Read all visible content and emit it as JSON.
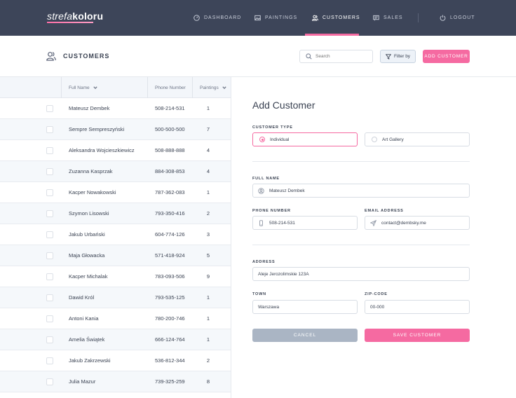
{
  "brand": {
    "part1": "strefa",
    "part2": "koloru"
  },
  "nav": {
    "items": [
      {
        "label": "DASHBOARD",
        "icon": "dashboard-icon"
      },
      {
        "label": "PAINTINGS",
        "icon": "image-icon"
      },
      {
        "label": "CUSTOMERS",
        "icon": "users-icon",
        "active": true
      },
      {
        "label": "SALES",
        "icon": "sales-icon"
      }
    ],
    "logout": "LOGOUT"
  },
  "header": {
    "title": "CUSTOMERS",
    "search_placeholder": "Search",
    "filter_label": "Filter by",
    "add_label": "ADD CUSTOMER"
  },
  "table": {
    "columns": {
      "name": "Full Name",
      "phone": "Phone Number",
      "paintings": "Paintings"
    },
    "rows": [
      {
        "name": "Mateusz Dembek",
        "phone": "508-214-531",
        "paintings": "1"
      },
      {
        "name": "Sempre Sempreszyński",
        "phone": "500-500-500",
        "paintings": "7"
      },
      {
        "name": "Aleksandra Wojcieszkiewicz",
        "phone": "508-888-888",
        "paintings": "4"
      },
      {
        "name": "Zuzanna Kasprzak",
        "phone": "884-308-853",
        "paintings": "4"
      },
      {
        "name": "Kacper Nowakowski",
        "phone": "787-362-083",
        "paintings": "1"
      },
      {
        "name": "Szymon Lisowski",
        "phone": "793-350-416",
        "paintings": "2"
      },
      {
        "name": "Jakub Urbański",
        "phone": "604-774-126",
        "paintings": "3"
      },
      {
        "name": "Maja Głowacka",
        "phone": "571-418-924",
        "paintings": "5"
      },
      {
        "name": "Kacper Michalak",
        "phone": "783-093-506",
        "paintings": "9"
      },
      {
        "name": "Dawid Król",
        "phone": "793-535-125",
        "paintings": "1"
      },
      {
        "name": "Antoni Kania",
        "phone": "780-200-746",
        "paintings": "1"
      },
      {
        "name": "Amelia Świątek",
        "phone": "666-124-764",
        "paintings": "1"
      },
      {
        "name": "Jakub Zakrzewski",
        "phone": "536-812-344",
        "paintings": "2"
      },
      {
        "name": "Julia Mazur",
        "phone": "739-325-259",
        "paintings": "8"
      }
    ]
  },
  "form": {
    "title": "Add Customer",
    "customer_type_label": "CUSTOMER TYPE",
    "type_individual": "Individual",
    "type_gallery": "Art Gallery",
    "selected_type": "Individual",
    "full_name_label": "FULL NAME",
    "full_name_value": "Mateusz Dembek",
    "phone_label": "PHONE NUMBER",
    "phone_value": "508-214-531",
    "email_label": "EMAIL ADDRESS",
    "email_value": "contact@dembsky.me",
    "address_label": "ADDRESS",
    "address_value": "Aleje Jerozolimskie 123A",
    "town_label": "TOWN",
    "town_value": "Warszawa",
    "zip_label": "ZIP-CODE",
    "zip_value": "00-000",
    "cancel_label": "CANCEL",
    "save_label": "SAVE CUSTOMER"
  },
  "colors": {
    "nav_bg": "#3d4559",
    "accent": "#f56aa1",
    "cancel": "#aab5c4"
  }
}
